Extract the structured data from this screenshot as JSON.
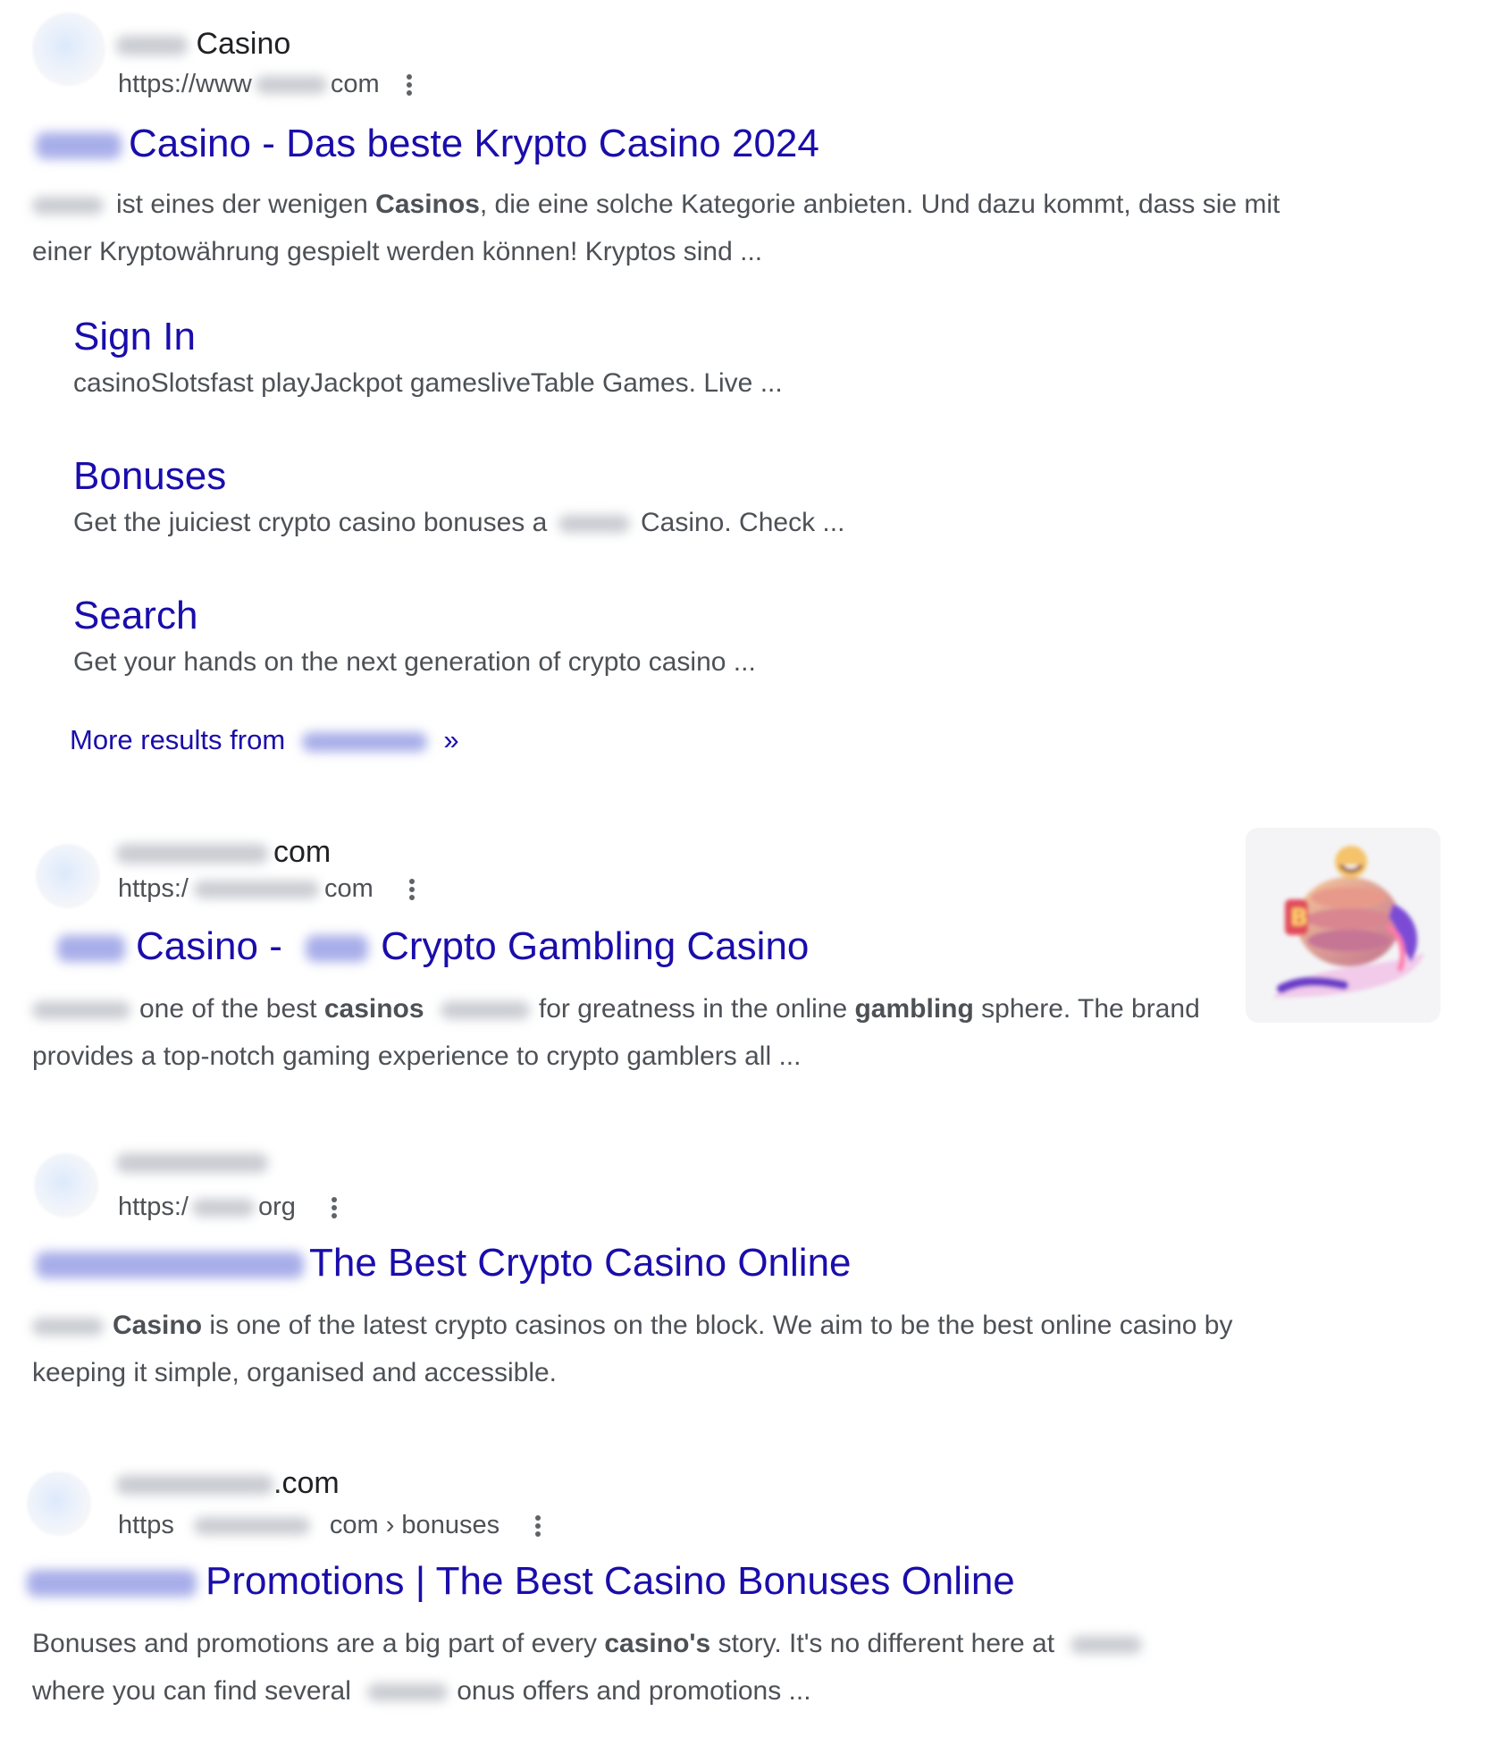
{
  "results": [
    {
      "site_name": "Casino",
      "url_prefix": "https://www",
      "url_suffix": "com",
      "title": "Casino - Das beste Krypto Casino 2024",
      "snippet": {
        "p1": "ist eines der wenigen ",
        "b1": "Casinos",
        "p2": ", die eine solche Kategorie anbieten. Und dazu kommt, dass sie mit einer Kryptowährung gespielt werden können! Kryptos sind ..."
      },
      "sitelinks": [
        {
          "title": "Sign In",
          "desc": "casinoSlotsfast playJackpot gamesliveTable Games. Live ..."
        },
        {
          "title": "Bonuses",
          "desc_a": "Get the juiciest crypto casino bonuses a",
          "desc_b": "Casino. Check ..."
        },
        {
          "title": "Search",
          "desc": "Get your hands on the next generation of crypto casino ..."
        }
      ],
      "more_results_label": "More results from",
      "more_results_arrow": "»"
    },
    {
      "site_name": "com",
      "url_prefix": "https:/",
      "url_suffix": "com",
      "title_a": "Casino -",
      "title_b": "Crypto Gambling Casino",
      "snippet": {
        "p1": "one of the best ",
        "b1": "casinos",
        "p2": "for greatness in the online ",
        "b2": "gambling",
        "p3": " sphere. The brand provides a top-notch gaming experience to crypto gamblers all ..."
      }
    },
    {
      "url_prefix": "https:/",
      "url_suffix": "org",
      "title": "The Best Crypto Casino Online",
      "snippet": {
        "b1": "Casino",
        "p1": " is one of the latest crypto casinos on the block. We aim to be the best online casino by keeping it simple, organised and accessible."
      }
    },
    {
      "site_name": ".com",
      "url_prefix": "https",
      "url_suffix": "com › bonuses",
      "title": "Promotions | The Best Casino Bonuses Online",
      "snippet": {
        "p1": "Bonuses and promotions are a big part of every ",
        "b1": "casino's",
        "p2": " story. It's no different here at",
        "p3": "where you can find several",
        "p4": "onus offers and promotions ..."
      }
    }
  ],
  "icons": {
    "more": "more-vert-icon",
    "favicon": "globe-favicon-icon",
    "thumbnail": "mascot-thumbnail-image"
  },
  "colors": {
    "link": "#1a0dab",
    "text": "#4d5156",
    "site_name": "#202124"
  }
}
